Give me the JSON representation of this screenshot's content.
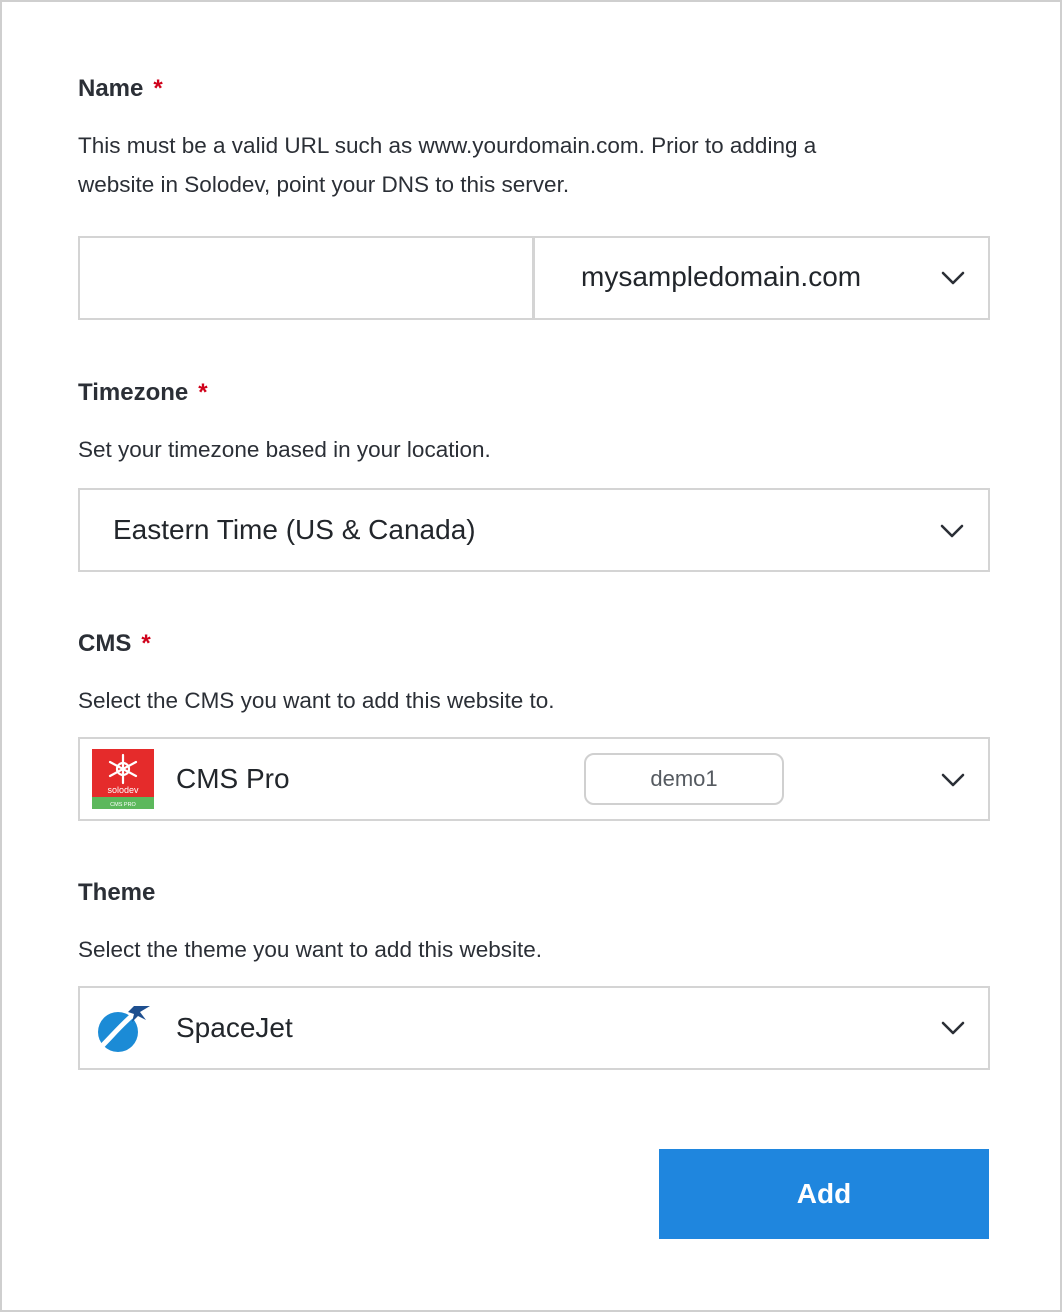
{
  "name_field": {
    "label": "Name",
    "required_mark": "*",
    "help_line1": "This must be a valid URL such as www.yourdomain.com. Prior to adding a",
    "help_line2": "website in Solodev, point your DNS to this server.",
    "subdomain_value": "",
    "domain_value": "mysampledomain.com"
  },
  "timezone_field": {
    "label": "Timezone",
    "required_mark": "*",
    "help": "Set your timezone based in your location.",
    "value": "Eastern Time (US & Canada)"
  },
  "cms_field": {
    "label": "CMS",
    "required_mark": "*",
    "help": "Select the CMS you want to add this website to.",
    "value": "CMS Pro",
    "badge": "demo1",
    "logo_word": "solodev",
    "logo_sub": "CMS PRO"
  },
  "theme_field": {
    "label": "Theme",
    "help": "Select the theme you want to add this website.",
    "value": "SpaceJet"
  },
  "actions": {
    "add_label": "Add"
  },
  "colors": {
    "accent": "#1f86de",
    "required": "#d0021b",
    "solodev_red": "#e52b2b",
    "solodev_green": "#5cb85c",
    "spacejet_blue": "#1b8bd6"
  },
  "icons": {
    "chevron": "chevron-down-icon",
    "cms_logo": "solodev-logo-icon",
    "theme_logo": "spacejet-logo-icon"
  }
}
